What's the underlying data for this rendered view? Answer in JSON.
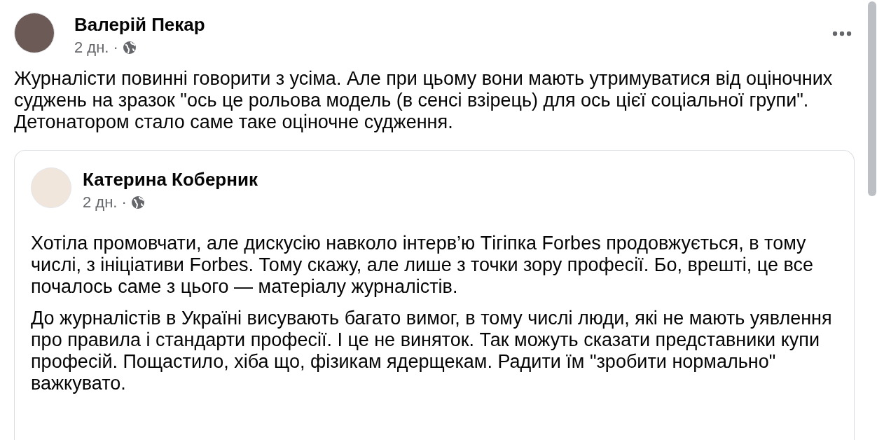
{
  "post": {
    "author": "Валерій Пекар",
    "time": "2 дн.",
    "separator": "·",
    "text": "Журналісти повинні говорити з усіма. Але при цьому вони мають утримуватися від оціночних суджень на зразок \"ось це рольова модель (в сенсі взірець) для ось цієї соціальної групи\". Детонатором стало саме таке оціночне судження."
  },
  "shared_post": {
    "author": "Катерина Коберник",
    "time": "2 дн.",
    "separator": "·",
    "paragraphs": [
      "Хотіла промовчати, але дискусію навколо інтерв’ю Тігіпка Forbes продовжується, в тому числі, з ініціативи Forbes. Тому скажу, але лише з точки зору професії. Бо, врешті, це все почалось саме з цього — матеріалу журналістів.",
      "До журналістів в Україні висувають багато вимог, в тому числі люди, які не мають уявлення про правила і стандарти професії. І це не виняток. Так можуть сказати представники купи професій. Пощастило, хіба що, фізикам ядерщекам. Радити їм \"зробити нормально\" важкувато."
    ]
  }
}
